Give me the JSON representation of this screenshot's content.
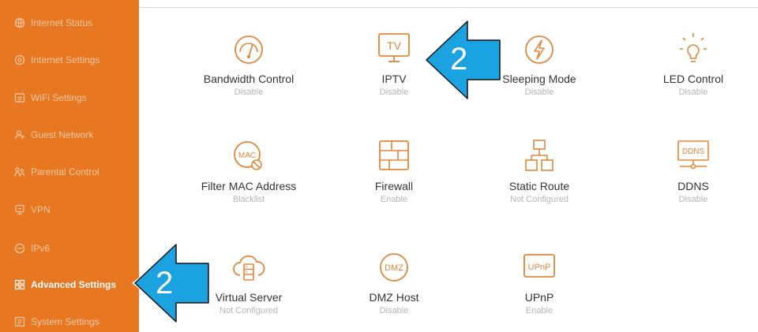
{
  "colors": {
    "brand": "#e87722",
    "sidebar_text": "#f7c8a4",
    "tile_icon": "#e0873b",
    "callout_fill": "#1aa3e0"
  },
  "sidebar": {
    "items": [
      {
        "label": "Internet Status",
        "icon": "globe-icon"
      },
      {
        "label": "Internet Settings",
        "icon": "settings-icon"
      },
      {
        "label": "WiFi Settings",
        "icon": "wifi-icon"
      },
      {
        "label": "Guest Network",
        "icon": "guest-icon"
      },
      {
        "label": "Parental Control",
        "icon": "family-icon"
      },
      {
        "label": "VPN",
        "icon": "vpn-icon"
      },
      {
        "label": "IPv6",
        "icon": "ipv6-icon"
      },
      {
        "label": "Advanced Settings",
        "icon": "grid-icon",
        "active": true
      },
      {
        "label": "System Settings",
        "icon": "system-icon"
      }
    ]
  },
  "tiles": [
    {
      "name": "Bandwidth Control",
      "status": "Disable",
      "icon": "gauge-icon"
    },
    {
      "name": "IPTV",
      "status": "Disable",
      "icon": "tv-icon"
    },
    {
      "name": "Sleeping Mode",
      "status": "Disable",
      "icon": "bolt-icon"
    },
    {
      "name": "LED Control",
      "status": "Disable",
      "icon": "led-bulb-icon"
    },
    {
      "name": "Filter MAC Address",
      "status": "Blacklist",
      "icon": "mac-filter-icon"
    },
    {
      "name": "Firewall",
      "status": "Enable",
      "icon": "firewall-icon"
    },
    {
      "name": "Static Route",
      "status": "Not Configured",
      "icon": "route-icon"
    },
    {
      "name": "DDNS",
      "status": "Disable",
      "icon": "ddns-icon"
    },
    {
      "name": "Virtual Server",
      "status": "Not Configured",
      "icon": "cloud-server-icon"
    },
    {
      "name": "DMZ Host",
      "status": "Disable",
      "icon": "dmz-icon"
    },
    {
      "name": "UPnP",
      "status": "Enable",
      "icon": "upnp-icon"
    }
  ],
  "icon_text": {
    "tv": "TV",
    "mac": "MAC",
    "ddns": "DDNS",
    "dmz": "DMZ",
    "upnp": "UPnP"
  },
  "callouts": {
    "top": "2",
    "bottom": "2"
  }
}
